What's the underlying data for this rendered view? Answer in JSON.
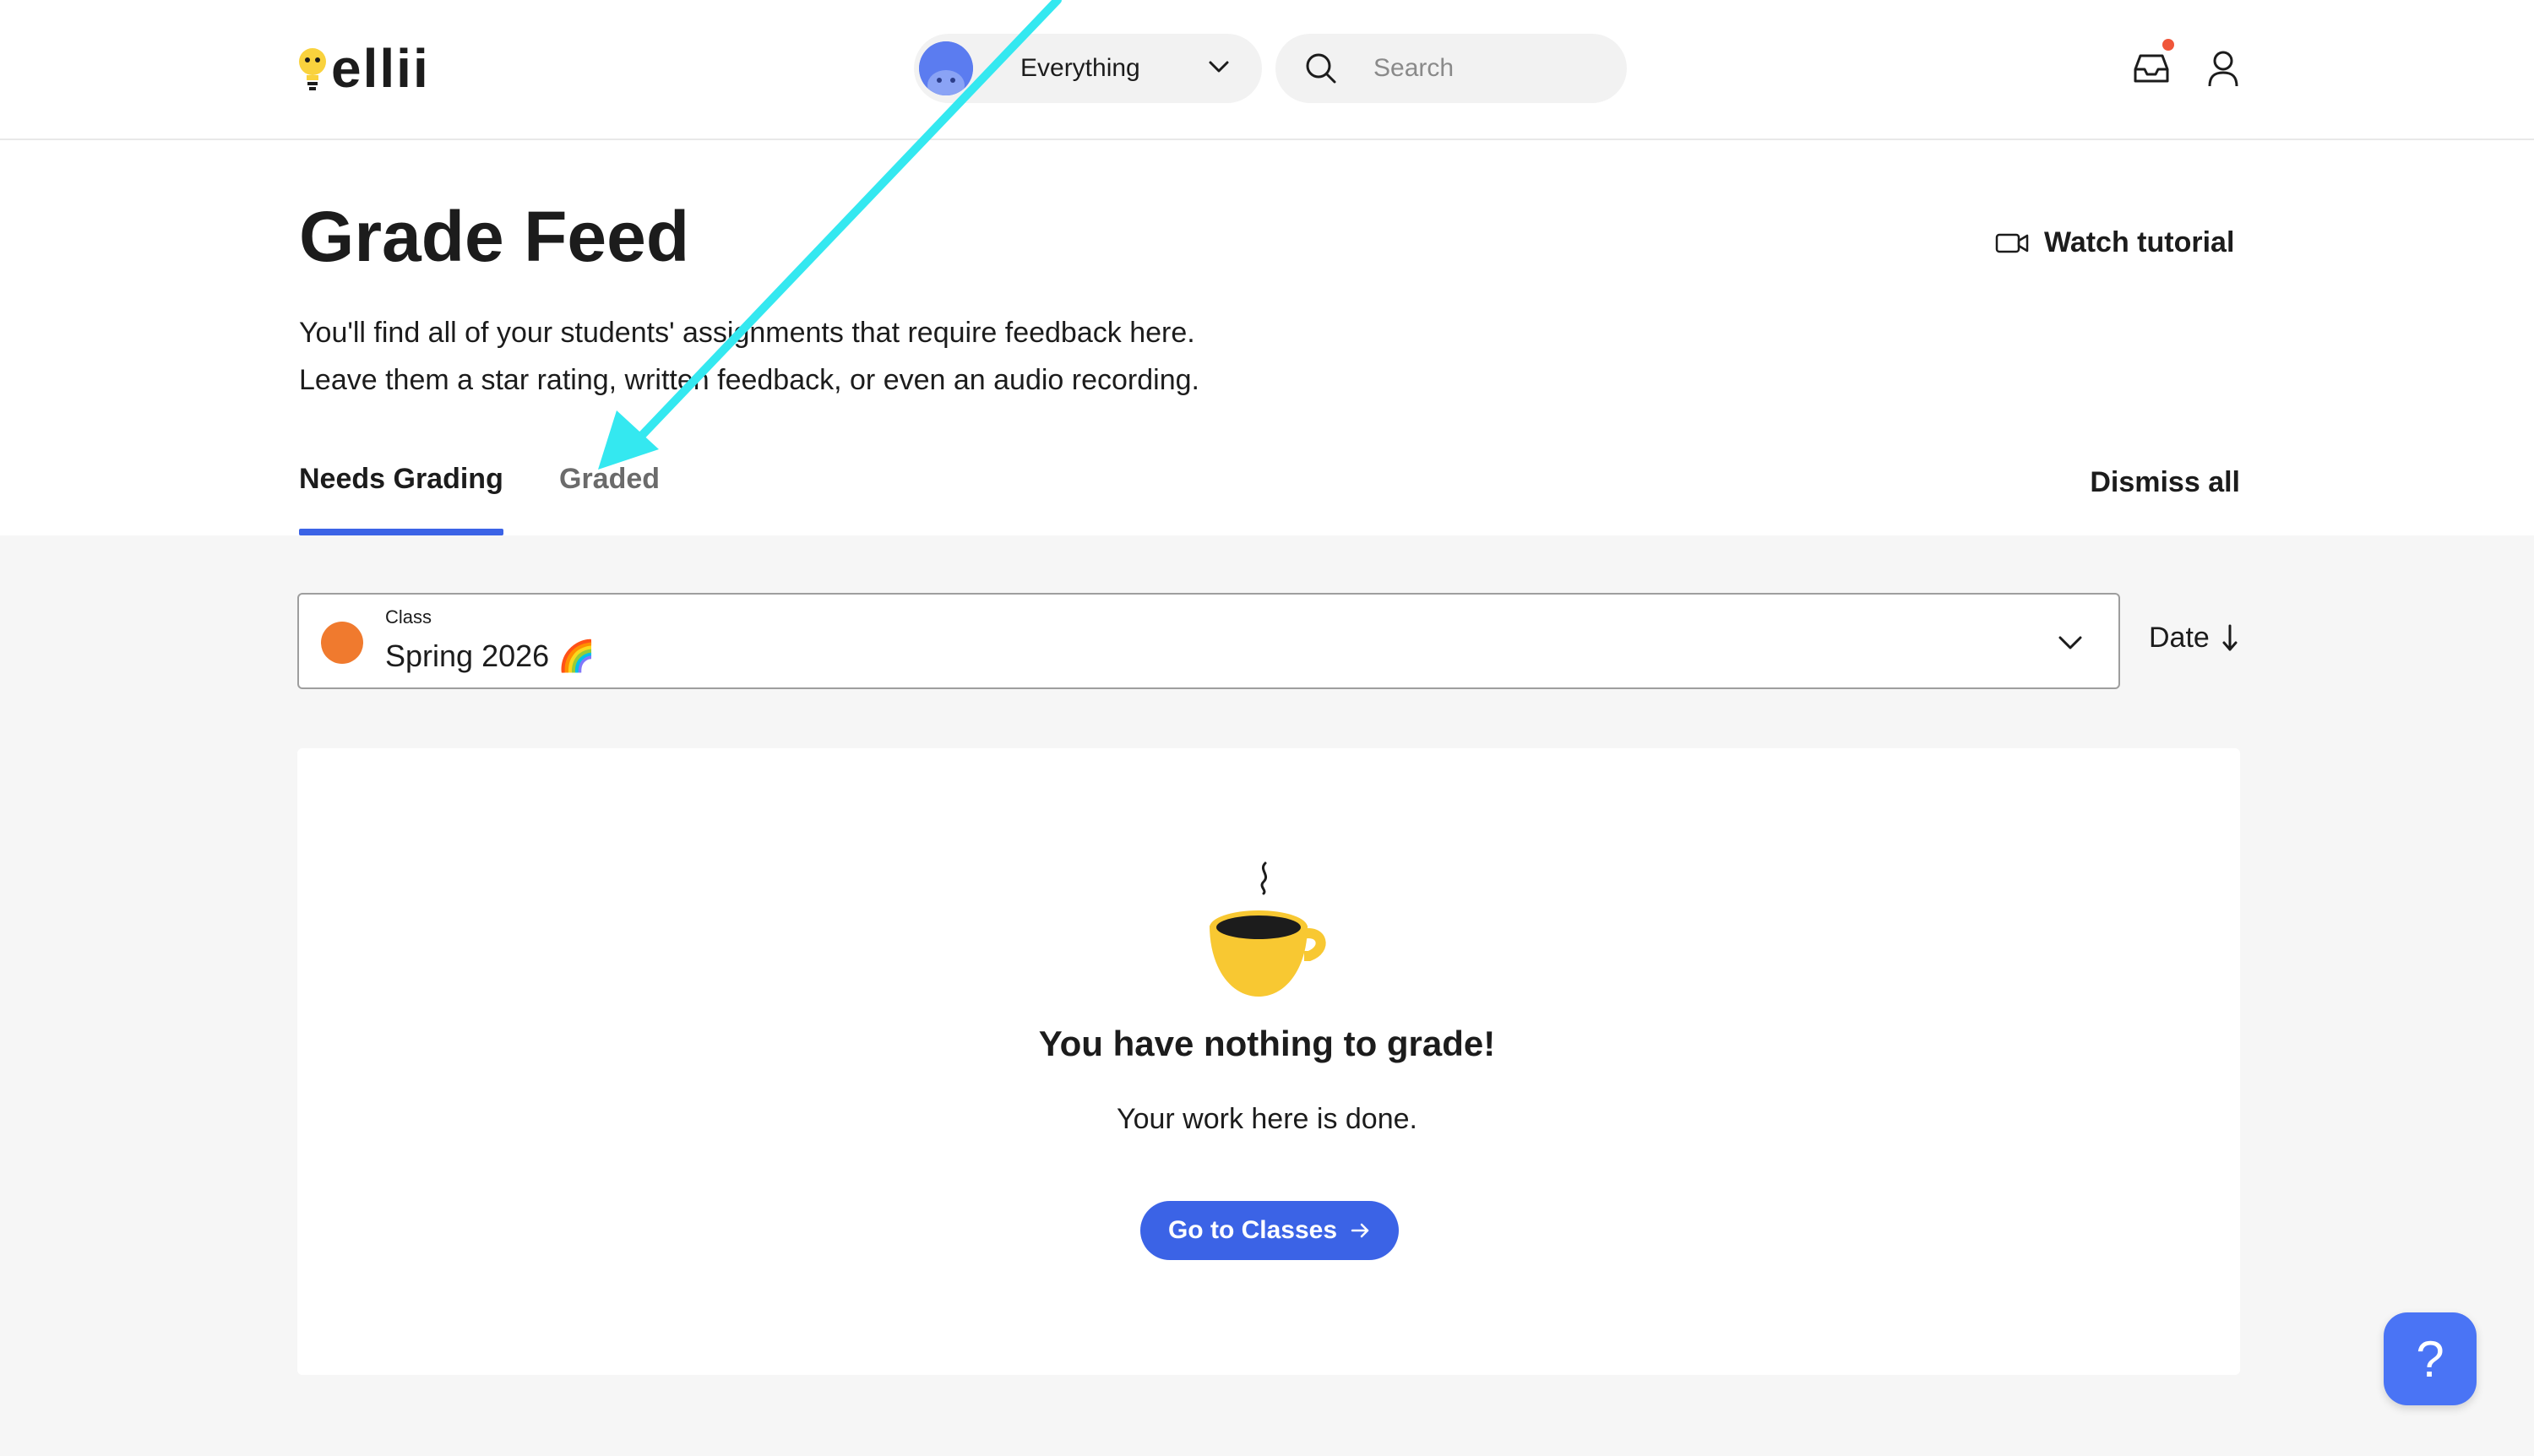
{
  "header": {
    "logo_text": "ellii",
    "scope_label": "Everything",
    "search_placeholder": "Search",
    "icons": [
      "bulb-icon",
      "chevron-down-icon",
      "search-icon",
      "inbox-icon",
      "user-icon"
    ],
    "notification_color": "#f0563a"
  },
  "page": {
    "title": "Grade Feed",
    "description_line1": "You'll find all of your students' assignments that require feedback here.",
    "description_line2": "Leave them a star rating, written feedback, or even an audio recording.",
    "watch_tutorial": "Watch tutorial"
  },
  "tabs": [
    {
      "label": "Needs Grading",
      "active": true
    },
    {
      "label": "Graded",
      "active": false
    }
  ],
  "dismiss_all": "Dismiss all",
  "filter": {
    "class_label": "Class",
    "class_value": "Spring 2026 🌈",
    "class_color": "#f07a2e",
    "sort_label": "Date"
  },
  "empty_state": {
    "title": "You have nothing to grade!",
    "subtitle": "Your work here is done.",
    "button_label": "Go to Classes"
  },
  "help_label": "?",
  "colors": {
    "accent": "#3b63e6",
    "annotation_arrow": "#34e8f0"
  }
}
